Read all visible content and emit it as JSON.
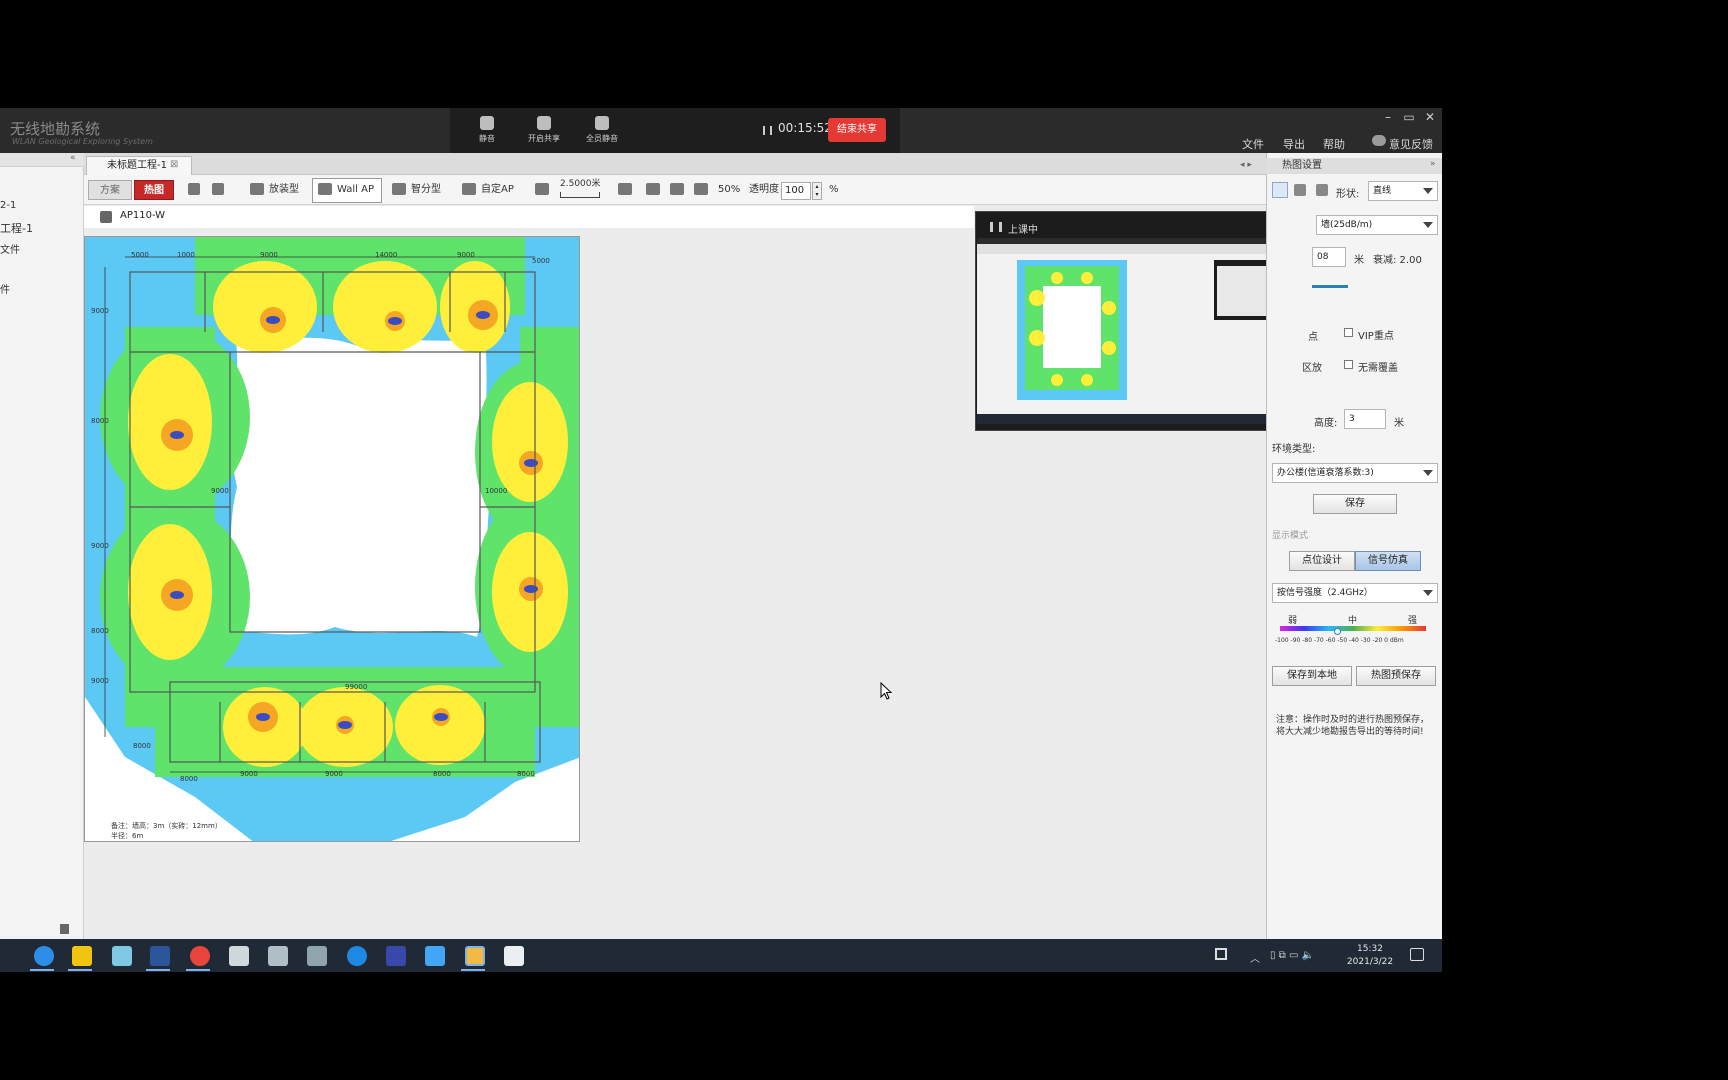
{
  "app": {
    "title": "无线地勘系统",
    "subtitle": "WLAN Geological Exploring System",
    "menu": [
      "文件",
      "导出",
      "帮助"
    ],
    "feedback": "意见反馈",
    "window_controls": [
      "–",
      "▭",
      "✕"
    ]
  },
  "meeting": {
    "tools": [
      "静音",
      "开启共享",
      "全员静音"
    ],
    "timer": "00:15:52",
    "stop_share": "结束共享"
  },
  "left_tree": [
    "2-1",
    "工程-1",
    "文件",
    "件"
  ],
  "document_tab": {
    "label": "未标题工程-1",
    "close": "⊠"
  },
  "toolbar": {
    "plan": "方案",
    "heatmap": "热图",
    "mode_items": [
      "放装型",
      "Wall AP",
      "智分型",
      "自定AP"
    ],
    "scale": "2.5000米",
    "zoom": "50%",
    "opacity_label": "透明度",
    "opacity_value": "100",
    "percent": "%"
  },
  "ap_model": "AP110-W",
  "floorplan": {
    "dimensions_top": [
      "5000",
      "1000",
      "9000",
      "14000",
      "9000",
      "5000"
    ],
    "dimensions_left": [
      "9000",
      "8000",
      "9000",
      "8000",
      "9000",
      "8000"
    ],
    "dimensions_bottom": [
      "8000",
      "9000",
      "9000",
      "8000",
      "8000"
    ],
    "dim_middle": "99000",
    "dim_inner_top": "9000",
    "dim_inner_bottom": "10000",
    "footer_line1": "备注：墙高：3m（实砖：12mm）",
    "footer_line2": "半径：6m"
  },
  "preview": {
    "title": "上课中"
  },
  "right_panel": {
    "header": "热图设置",
    "shape_label": "形状:",
    "shape_value": "直线",
    "wall_select": "墙(25dB/m)",
    "thickness_value": "08",
    "meter": "米",
    "attenuation": "衰减: 2.00",
    "vip_point": "VIP重点",
    "no_coverage": "无需覆盖",
    "partial_label_1": "点",
    "partial_label_2": "区放",
    "height_label": "高度:",
    "height_value": "3",
    "env_type_label": "环境类型:",
    "env_type_value": "办公楼(信道衰落系数:3)",
    "save": "保存",
    "display_mode_label": "显示模式",
    "mode_point": "点位设计",
    "mode_signal": "信号仿真",
    "signal_select": "按信号强度（2.4GHz）",
    "legend_weak": "弱",
    "legend_mid": "中",
    "legend_strong": "强",
    "legend_ticks": "-100 -90 -80 -70 -60 -50 -40 -30 -20  0 dBm",
    "save_local": "保存到本地",
    "heat_save": "热图预保存",
    "note": "注意：操作时及时的进行热图预保存，将大大减少地勘报告导出的等待时间!"
  },
  "taskbar": {
    "time": "15:32",
    "date": "2021/3/22"
  },
  "colors": {
    "heat_strong": "#f5a623",
    "heat_good": "#ffef3b",
    "heat_mid": "#5fe36a",
    "heat_weak": "#5cc9f5",
    "accent_red": "#c62828",
    "stop_red": "#e53935"
  }
}
